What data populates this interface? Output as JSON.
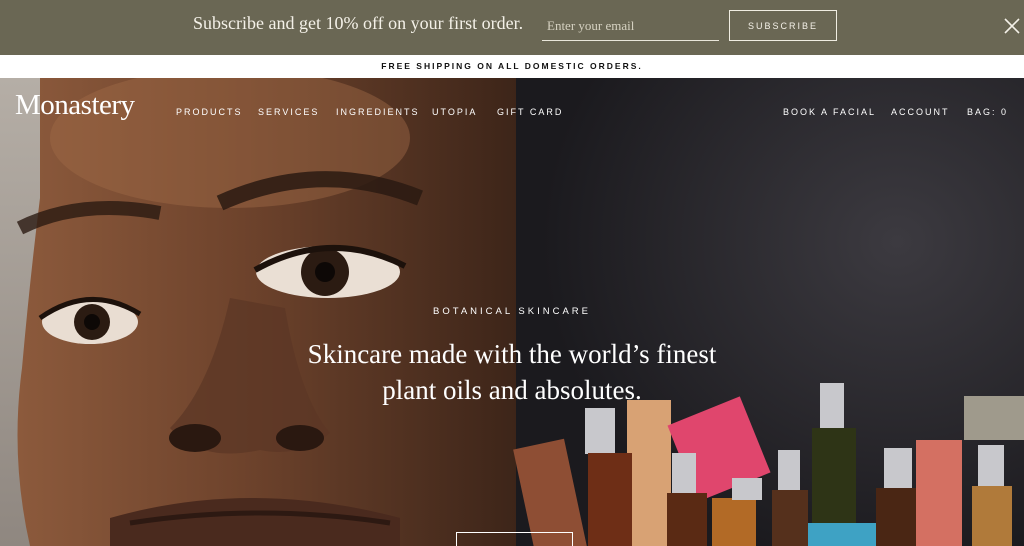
{
  "promo": {
    "text": "Subscribe and get 10% off on your first order.",
    "email_placeholder": "Enter your email",
    "subscribe_label": "SUBSCRIBE"
  },
  "shipping": {
    "text": "FREE SHIPPING ON ALL DOMESTIC ORDERS."
  },
  "header": {
    "logo": "Monastery",
    "nav_left": [
      "PRODUCTS",
      "SERVICES",
      "INGREDIENTS",
      "UTOPIA",
      "GIFT CARD"
    ],
    "nav_right": [
      "BOOK A FACIAL",
      "ACCOUNT",
      "BAG: 0"
    ]
  },
  "hero": {
    "eyebrow": "BOTANICAL SKINCARE",
    "headline_line1": "Skincare made with the world’s finest",
    "headline_line2": "plant oils and absolutes."
  },
  "icons": {
    "close": "close-icon"
  },
  "colors": {
    "promo_bg": "#6a6754",
    "shipping_bg": "#ffffff",
    "text_light": "#ffffff"
  }
}
